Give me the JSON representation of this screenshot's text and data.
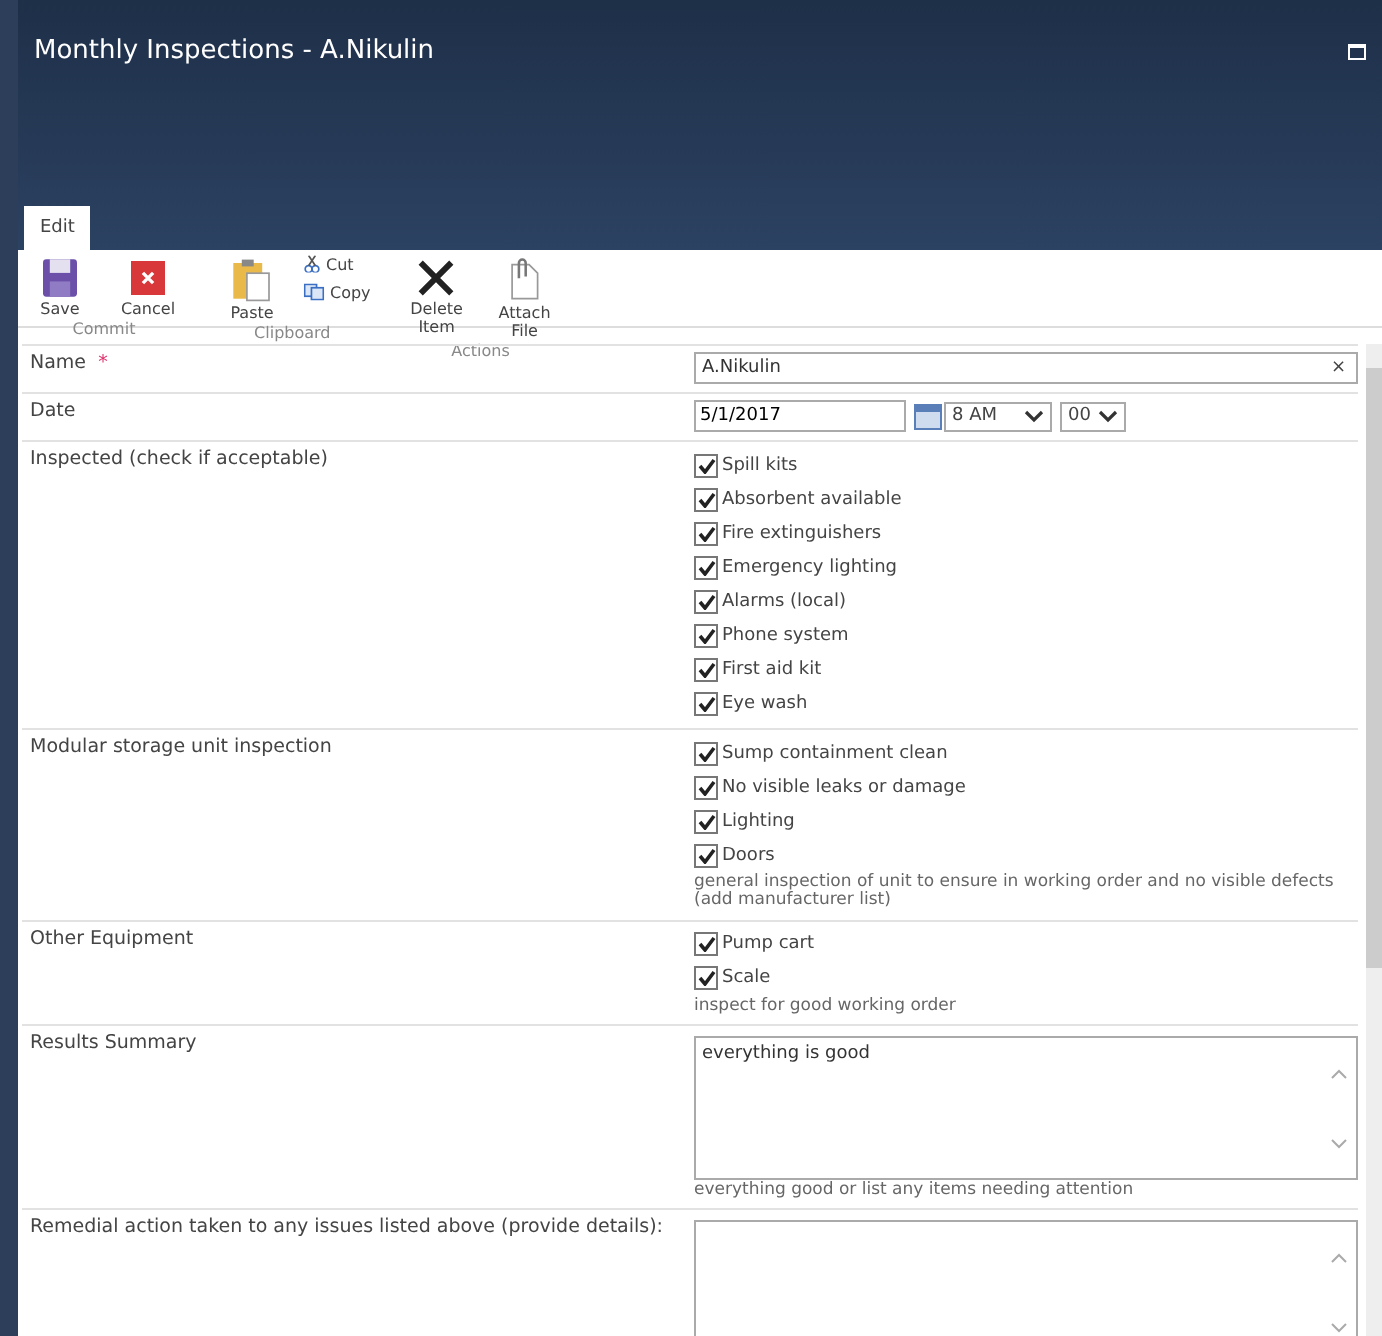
{
  "window": {
    "title": "Monthly Inspections - A.Nikulin"
  },
  "tabs": [
    {
      "label": "Edit",
      "selected": true
    }
  ],
  "ribbon": [
    {
      "group": "Commit",
      "buttons": [
        {
          "kind": "save",
          "label": "Save"
        },
        {
          "kind": "cancel",
          "label": "Cancel"
        }
      ]
    },
    {
      "group": "Clipboard",
      "buttons": [
        {
          "kind": "paste",
          "label": "Paste"
        },
        {
          "kind": "cut",
          "label": "Cut"
        },
        {
          "kind": "copy",
          "label": "Copy"
        }
      ]
    },
    {
      "group": "Actions",
      "buttons": [
        {
          "kind": "delete",
          "label": "Delete Item"
        },
        {
          "kind": "attach",
          "label": "Attach File"
        }
      ]
    }
  ],
  "fields": [
    {
      "kind": "text",
      "label": "Name",
      "required": true,
      "required_mark": "*",
      "value": "A.Nikulin",
      "clear": "×"
    },
    {
      "kind": "date",
      "label": "Date",
      "value": "5/1/2017",
      "hour": "8 AM",
      "minute": "00"
    },
    {
      "kind": "checkboxes",
      "label": "Inspected (check if acceptable)",
      "options": [
        {
          "label": "Spill kits",
          "checked": true
        },
        {
          "label": "Absorbent available",
          "checked": true
        },
        {
          "label": "Fire extinguishers",
          "checked": true
        },
        {
          "label": "Emergency lighting",
          "checked": true
        },
        {
          "label": "Alarms (local)",
          "checked": true
        },
        {
          "label": "Phone system",
          "checked": true
        },
        {
          "label": "First aid kit",
          "checked": true
        },
        {
          "label": "Eye wash",
          "checked": true
        }
      ]
    },
    {
      "kind": "checkboxes",
      "label": "Modular storage unit inspection",
      "options": [
        {
          "label": "Sump containment clean",
          "checked": true
        },
        {
          "label": "No visible leaks or damage",
          "checked": true
        },
        {
          "label": "Lighting",
          "checked": true
        },
        {
          "label": "Doors",
          "checked": true
        }
      ],
      "description": "general inspection of unit to ensure in working order and no visible defects (add manufacturer list)"
    },
    {
      "kind": "checkboxes",
      "label": "Other Equipment",
      "options": [
        {
          "label": "Pump cart",
          "checked": true
        },
        {
          "label": "Scale",
          "checked": true
        }
      ],
      "description": "inspect for good working order"
    },
    {
      "kind": "textarea",
      "label": "Results Summary",
      "value": "everything is good",
      "description": "everything good or list any items needing attention"
    },
    {
      "kind": "textarea",
      "label": "Remedial action taken to any issues listed above (provide details):"
    }
  ]
}
